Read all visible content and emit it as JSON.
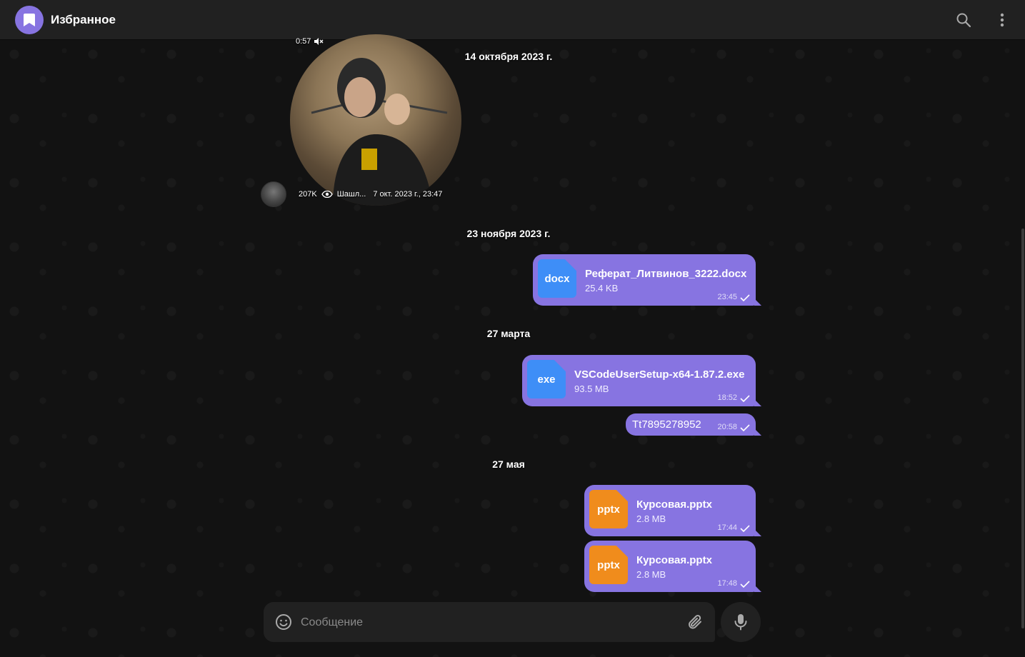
{
  "header": {
    "title": "Избранное"
  },
  "dates": [
    "14 октября 2023 г.",
    "23 ноября 2023 г.",
    "27 марта",
    "27 мая"
  ],
  "video_message": {
    "duration": "0:57",
    "views": "207K",
    "author": "Шашл...",
    "timestamp": "7 окт. 2023 г., 23:47"
  },
  "messages": [
    {
      "ext": "docx",
      "name": "Реферат_Литвинов_3222.docx",
      "size": "25.4 KB",
      "time": "23:45"
    },
    {
      "ext": "exe",
      "name": "VSCodeUserSetup-x64-1.87.2.exe",
      "size": "93.5 MB",
      "time": "18:52"
    },
    {
      "text": "Tt7895278952",
      "time": "20:58"
    },
    {
      "ext": "pptx",
      "name": "Курсовая.pptx",
      "size": "2.8 MB",
      "time": "17:44"
    },
    {
      "ext": "pptx",
      "name": "Курсовая.pptx",
      "size": "2.8 MB",
      "time": "17:48"
    }
  ],
  "composer": {
    "placeholder": "Сообщение"
  },
  "colors": {
    "accent": "#8774e1",
    "doc_blue": "#3e8ef7",
    "doc_orange": "#f08c1c",
    "panel": "#212121"
  }
}
